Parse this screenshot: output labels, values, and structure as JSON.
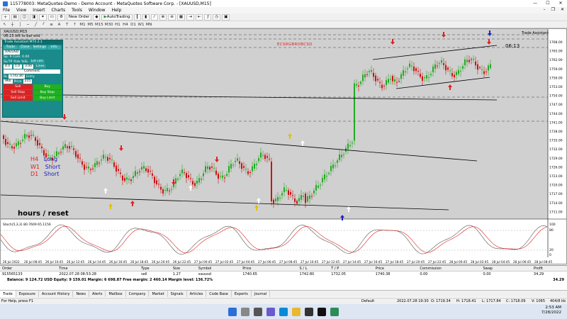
{
  "window": {
    "title": "115778003: MetaQuotes-Demo - Demo Account - MetaQuotes Software Corp. - [XAUUSD,M15]"
  },
  "menu": {
    "items": [
      "File",
      "View",
      "Insert",
      "Charts",
      "Tools",
      "Window",
      "Help"
    ]
  },
  "toolbar": {
    "new_order": "New Order",
    "autotrading": "AutoTrading"
  },
  "chart": {
    "title": "XAUUSD,M15",
    "subtitle": "06:13 left to bar end",
    "countdown": "06:13",
    "trade_label": "Trade Assistant",
    "red_banner": "ECSRGBROBCSD",
    "tf_labels": [
      {
        "tf": "H4",
        "dir": "Long",
        "tf_color": "#e02020",
        "dir_color": "#2020c0"
      },
      {
        "tf": "W1",
        "dir": "Short",
        "tf_color": "#e02020",
        "dir_color": "#2020c0"
      },
      {
        "tf": "D1",
        "dir": "Short",
        "tf_color": "#e02020",
        "dir_color": "#2020c0"
      }
    ],
    "hours_reset": "hours / reset",
    "indicator_label": "Stoch(5,3,3) 80.7609 65.1156",
    "price_axis": [
      "1768.00",
      "1765.00",
      "1762.00",
      "1759.00",
      "1756.00",
      "1753.00",
      "1750.00",
      "1747.00",
      "1744.00",
      "1741.00",
      "1738.00",
      "1735.00",
      "1732.00",
      "1729.00",
      "1726.00",
      "1723.00",
      "1720.00",
      "1717.00",
      "1714.00",
      "1711.00"
    ],
    "time_axis": [
      "26 Jul 2022",
      "26 Jul 08:45",
      "26 Jul 10:45",
      "26 Jul 12:45",
      "26 Jul 14:45",
      "26 Jul 16:45",
      "26 Jul 18:45",
      "26 Jul 20:45",
      "26 Jul 22:45",
      "27 Jul 00:45",
      "27 Jul 02:45",
      "27 Jul 04:45",
      "27 Jul 06:45",
      "27 Jul 08:45",
      "27 Jul 10:45",
      "27 Jul 12:45",
      "27 Jul 14:45",
      "27 Jul 16:45",
      "27 Jul 18:45",
      "27 Jul 20:45",
      "27 Jul 22:45",
      "28 Jul 00:45",
      "28 Jul 02:45",
      "28 Jul 04:45",
      "28 Jul 06:45",
      "28 Jul 08:45"
    ],
    "ind_axis": [
      "100",
      "80",
      "20",
      "0"
    ]
  },
  "panel": {
    "header": "Trade Assistant MT4 2.1",
    "tabs": [
      "Trade",
      "Close",
      "Settings",
      "Info"
    ],
    "symbol": "XAUUSD",
    "sp": "Sp: 9  Com: 0.00",
    "sltp": "SL/TP",
    "rr": "Risk %SL",
    "lot": "Lot calc",
    "sl_val": "4.0",
    "tp_val": "1.0",
    "lot_val": "3.00",
    "lines": "Lines",
    "comment": "Comment",
    "entry": "Entry",
    "price": "Price",
    "sl_label": "SL",
    "sl_price": "1742.80",
    "entry_price": "960",
    "tp_price": "215",
    "sell": "Sell",
    "buy": "Buy",
    "sell_stop": "Sell Stop",
    "buy_stop": "Buy Stop",
    "sell_limit": "Sell Limit",
    "buy_limit": "Buy Limit"
  },
  "terminal": {
    "columns": [
      "Order",
      "Time",
      "Type",
      "Size",
      "Symbol",
      "Price",
      "S / L",
      "T / P",
      "Price",
      "Commission",
      "Swap",
      "Profit"
    ],
    "rows": [
      [
        "915565133",
        "2022.07.28 08:53:28",
        "sell",
        "1.27",
        "xauusd",
        "1740.65",
        "1742.80",
        "1732.05",
        "1740.38",
        "0.00",
        "0.00",
        "34.29"
      ]
    ],
    "balance": "Balance: 9 124.72 USD  Equity: 9 159.01  Margin: 6 698.87  Free margin: 2 460.14  Margin level: 136.72%",
    "balance_profit": "34.29",
    "tabs": [
      "Trade",
      "Exposure",
      "Account History",
      "News",
      "Alerts",
      "Mailbox",
      "Company",
      "Market",
      "Signals",
      "Articles",
      "Code Base",
      "Experts",
      "Journal"
    ]
  },
  "status": {
    "help": "For Help, press F1",
    "profile": "Default",
    "datetime": "2022.07.28 19:30",
    "open": "O: 1719.34",
    "high": "H: 1718.41",
    "low": "L: 1717.84",
    "close": "C: 1718.09",
    "vol": "V: 1065",
    "traffic": "404/8 kb"
  },
  "taskbar": {
    "time": "2:53 AM",
    "date": "7/28/2022"
  },
  "colors": {
    "bull": "#22aa22",
    "bear": "#cc1111",
    "bg": "#ffffff",
    "panel": "#1a8a8a"
  }
}
